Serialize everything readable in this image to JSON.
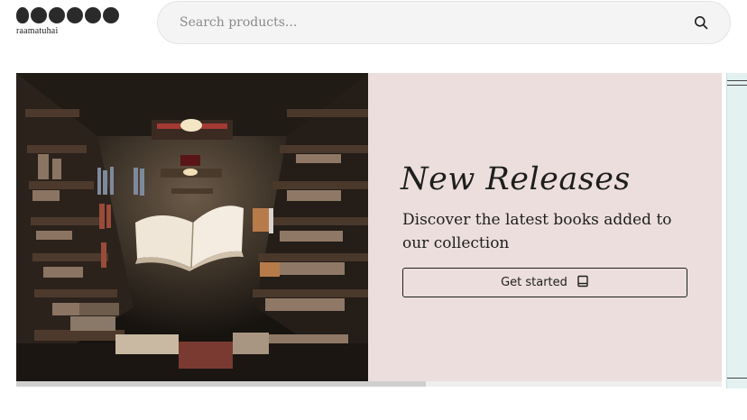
{
  "header": {
    "logo_text": "raamatuhai",
    "search": {
      "placeholder": "Search products...",
      "value": "",
      "icon": "search-icon"
    }
  },
  "hero": {
    "image_alt": "Open book floating in a library aisle",
    "title": "New Releases",
    "description": "Discover the latest books added to our collection",
    "cta_label": "Get started",
    "cta_icon": "book-icon",
    "panel_color": "#ecdedd",
    "progress": 0.58
  },
  "next_slide": {
    "color": "#e3f1f1"
  }
}
